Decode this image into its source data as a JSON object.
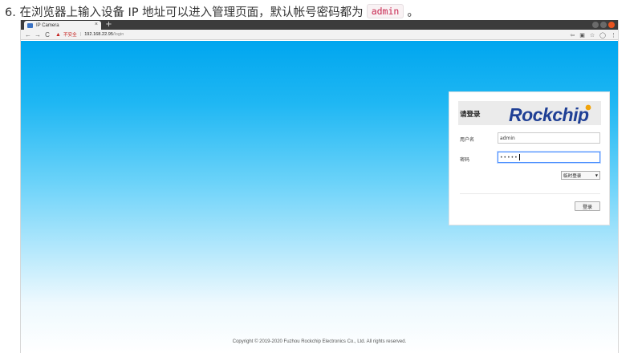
{
  "doc": {
    "step_text": "6. 在浏览器上输入设备 IP 地址可以进入管理页面，默认帐号密码都为",
    "step_code": "admin",
    "step_end": "。"
  },
  "browser": {
    "tab_title": "IP Camera",
    "tab_close": "×",
    "new_tab": "+",
    "nav": {
      "back": "←",
      "forward": "→",
      "reload": "C"
    },
    "omnibox": {
      "warning_glyph": "▲",
      "insecure_text": "不安全",
      "separator": "|",
      "url_host": "192.168.22.95",
      "url_path": "/login"
    },
    "toolbar_right": [
      "⇦",
      "▣",
      "☆",
      "◯",
      "⋮"
    ]
  },
  "login": {
    "title": "请登录",
    "brand": "Rockchip",
    "brand_color": "#1f3f95",
    "brand_dot_color": "#f0a30a",
    "username_label": "用户名",
    "username_value": "admin",
    "password_label": "密码",
    "password_value": "•••••",
    "session_select": "临时登录",
    "login_button": "登录"
  },
  "footer": {
    "copyright": "Copyright © 2019-2020 Fuzhou Rockchip Electronics Co., Ltd. All rights reserved."
  }
}
